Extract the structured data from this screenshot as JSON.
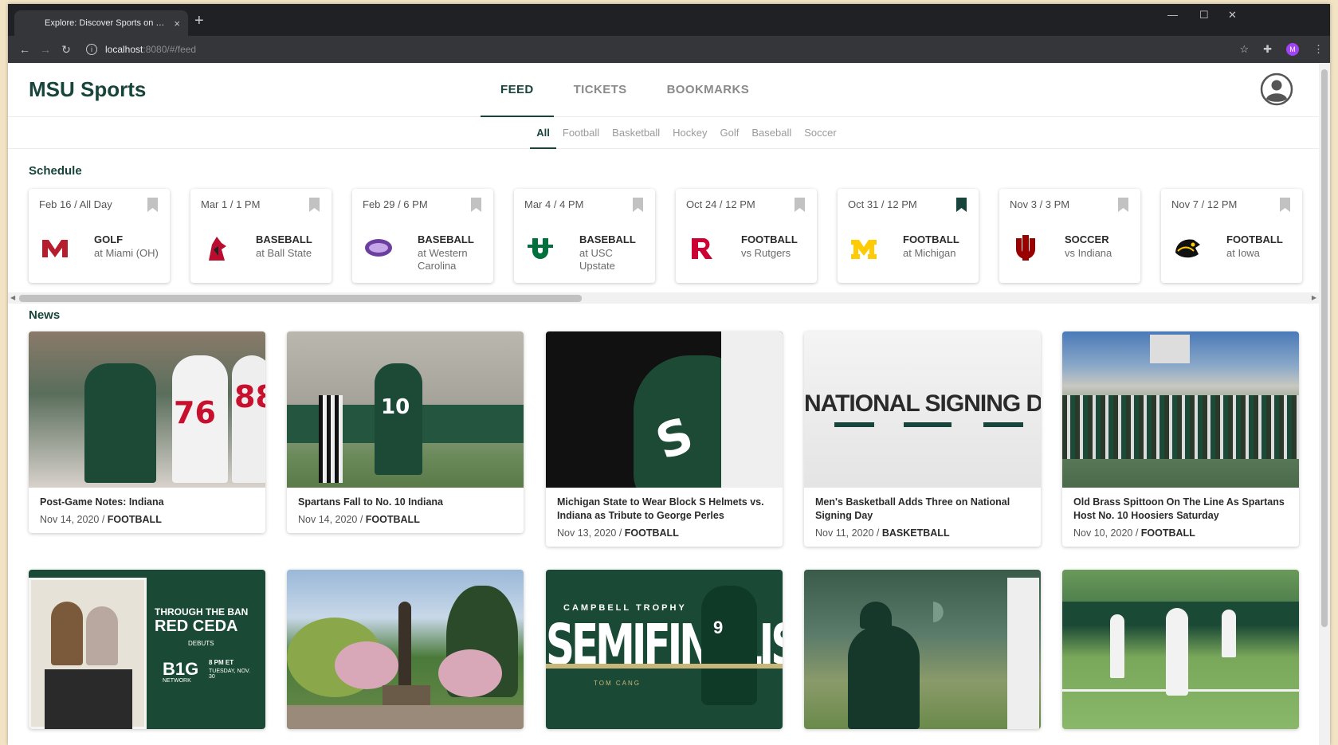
{
  "browser": {
    "tab_title": "Explore: Discover Sports on Cam",
    "tab_close": "×",
    "new_tab": "+",
    "url_host": "localhost",
    "url_rest": ":8080/#/feed"
  },
  "app": {
    "brand": "MSU Sports",
    "nav": [
      "FEED",
      "TICKETS",
      "BOOKMARKS"
    ],
    "filters": [
      "All",
      "Football",
      "Basketball",
      "Hockey",
      "Golf",
      "Baseball",
      "Soccer"
    ]
  },
  "schedule": {
    "title": "Schedule",
    "items": [
      {
        "date": "Feb 16 / All Day",
        "sport": "GOLF",
        "opponent": "at Miami (OH)",
        "logo": "miami-logo",
        "bookmarked": false
      },
      {
        "date": "Mar 1 / 1 PM",
        "sport": "BASEBALL",
        "opponent": "at Ball State",
        "logo": "ball-state-logo",
        "bookmarked": false
      },
      {
        "date": "Feb 29 / 6 PM",
        "sport": "BASEBALL",
        "opponent": "at Western Carolina",
        "logo": "western-carolina-logo",
        "bookmarked": false
      },
      {
        "date": "Mar 4 / 4 PM",
        "sport": "BASEBALL",
        "opponent": "at USC Upstate",
        "logo": "usc-upstate-logo",
        "bookmarked": false
      },
      {
        "date": "Oct 24 / 12 PM",
        "sport": "FOOTBALL",
        "opponent": "vs Rutgers",
        "logo": "rutgers-logo",
        "bookmarked": false
      },
      {
        "date": "Oct 31 / 12 PM",
        "sport": "FOOTBALL",
        "opponent": "at Michigan",
        "logo": "michigan-logo",
        "bookmarked": true
      },
      {
        "date": "Nov 3 / 3 PM",
        "sport": "SOCCER",
        "opponent": "vs Indiana",
        "logo": "indiana-logo",
        "bookmarked": false
      },
      {
        "date": "Nov 7 / 12 PM",
        "sport": "FOOTBALL",
        "opponent": "at Iowa",
        "logo": "iowa-logo",
        "bookmarked": false
      }
    ]
  },
  "news": {
    "title": "News",
    "items": [
      {
        "title": "Post-Game Notes: Indiana",
        "date": "Nov 14, 2020",
        "category": "FOOTBALL"
      },
      {
        "title": "Spartans Fall to No. 10 Indiana",
        "date": "Nov 14, 2020",
        "category": "FOOTBALL"
      },
      {
        "title": "Michigan State to Wear Block S Helmets vs. Indiana as Tribute to George Perles",
        "date": "Nov 13, 2020",
        "category": "FOOTBALL"
      },
      {
        "title": "Men's Basketball Adds Three on National Signing Day",
        "date": "Nov 11, 2020",
        "category": "BASKETBALL"
      },
      {
        "title": "Old Brass Spittoon On The Line As Spartans Host No. 10 Hoosiers Saturday",
        "date": "Nov 10, 2020",
        "category": "FOOTBALL"
      },
      {
        "image_text": [
          "THROUGH THE BAN",
          "RED CEDA",
          "DEBUTS",
          "B1G",
          "NETWORK",
          "8 PM ET",
          "TUESDAY, NOV. 30"
        ]
      },
      {},
      {
        "image_text": [
          "CAMPBELL TROPHY",
          "SEMIFINALIST",
          "TOM CANG"
        ]
      },
      {},
      {}
    ],
    "image_overlay": {
      "signing_day": "NATIONAL SIGNING DAY"
    }
  },
  "separator": " / ",
  "colors": {
    "brand_green": "#18453b",
    "bookmark_active": "#18453b",
    "bookmark_inactive": "#c2c2c2"
  }
}
